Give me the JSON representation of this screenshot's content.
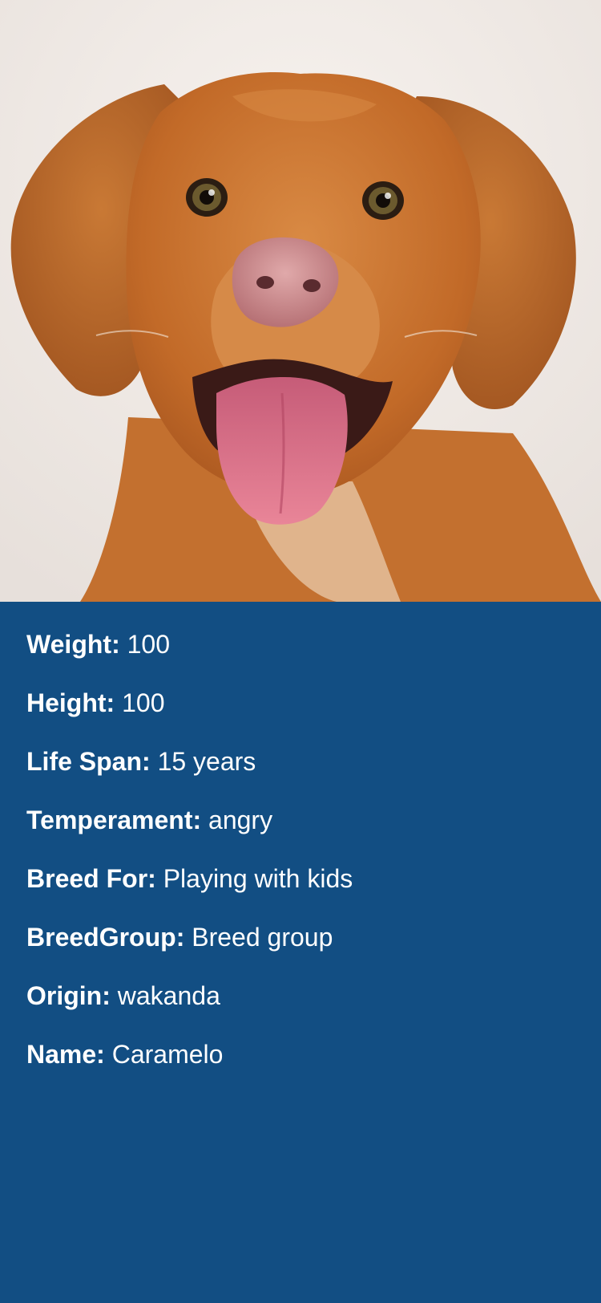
{
  "hero": {
    "image_subject": "smiling ginger dog"
  },
  "details": {
    "rows": [
      {
        "label": "Weight:",
        "value": "100"
      },
      {
        "label": "Height:",
        "value": "100"
      },
      {
        "label": "Life Span:",
        "value": "15 years"
      },
      {
        "label": "Temperament:",
        "value": "angry"
      },
      {
        "label": "Breed For:",
        "value": "Playing with kids"
      },
      {
        "label": "BreedGroup:",
        "value": "Breed group"
      },
      {
        "label": "Origin:",
        "value": "wakanda"
      },
      {
        "label": "Name:",
        "value": "Caramelo"
      }
    ]
  },
  "colors": {
    "background": "#124e83",
    "text": "#ffffff",
    "photo_background": "#f1ece8",
    "fur": "#c8742f",
    "tongue": "#d9657c",
    "nose": "#c98b8f"
  }
}
